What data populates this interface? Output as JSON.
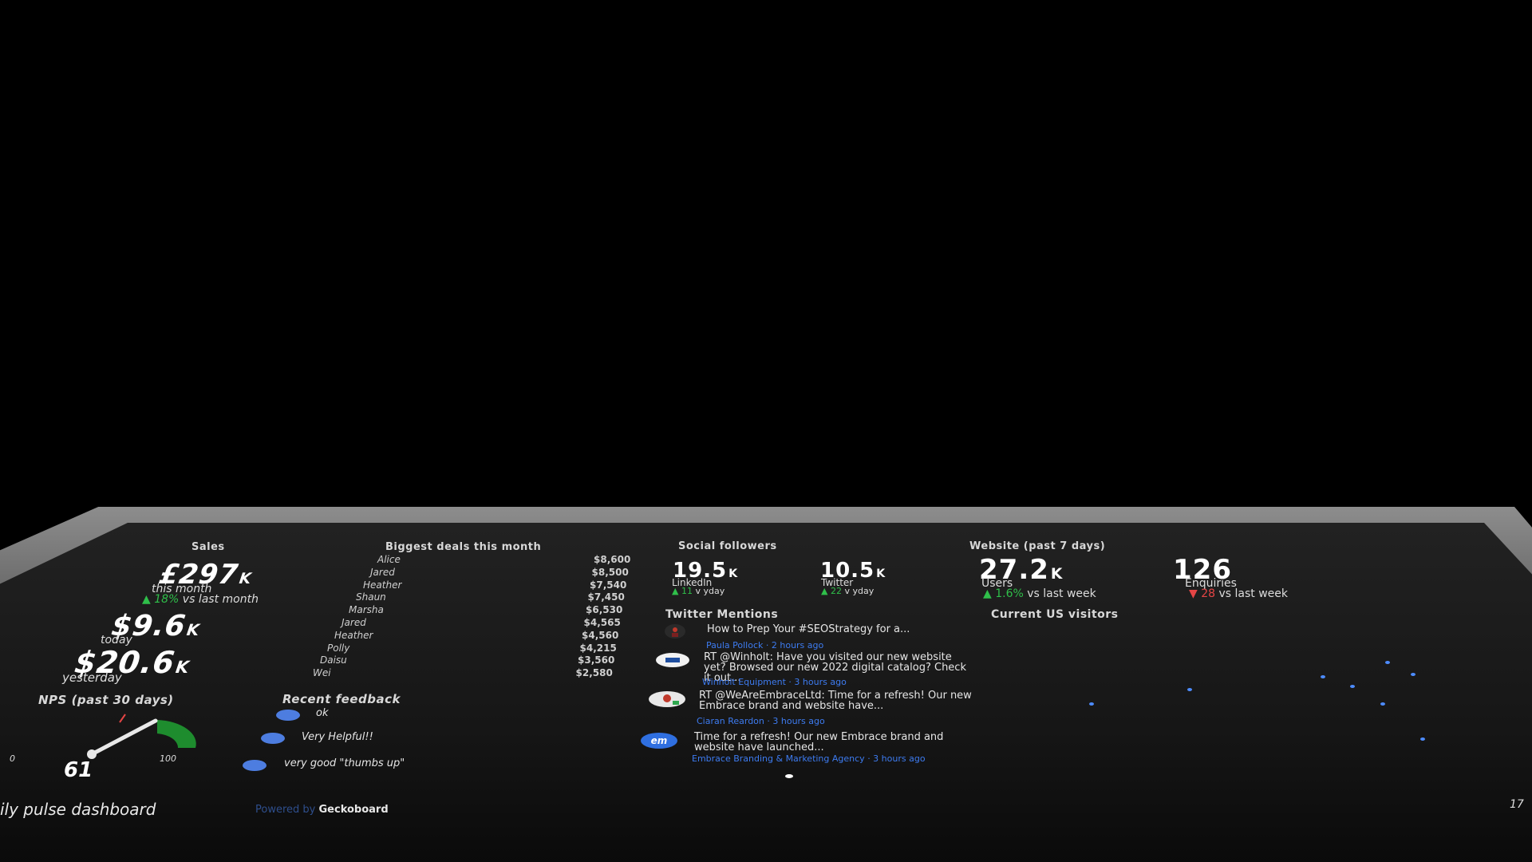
{
  "sales": {
    "title": "Sales",
    "month_value": "£297",
    "month_unit": "K",
    "month_label": "this month",
    "month_change": "▲ 18%",
    "month_change_suffix": "vs last month",
    "today_value": "$9.6",
    "today_unit": "K",
    "today_label": "today",
    "yesterday_value": "$20.6",
    "yesterday_unit": "K",
    "yesterday_label": "yesterday"
  },
  "deals": {
    "title": "Biggest deals this month",
    "rows": [
      {
        "name": "Alice",
        "value": "$8,600"
      },
      {
        "name": "Jared",
        "value": "$8,500"
      },
      {
        "name": "Heather",
        "value": "$7,540"
      },
      {
        "name": "Shaun",
        "value": "$7,450"
      },
      {
        "name": "Marsha",
        "value": "$6,530"
      },
      {
        "name": "Jared",
        "value": "$4,565"
      },
      {
        "name": "Heather",
        "value": "$4,560"
      },
      {
        "name": "Polly",
        "value": "$4,215"
      },
      {
        "name": "Daisu",
        "value": "$3,560"
      },
      {
        "name": "Wei",
        "value": "$2,580"
      }
    ]
  },
  "social": {
    "title": "Social followers",
    "linkedin_value": "19.5",
    "linkedin_unit": "K",
    "linkedin_label": "LinkedIn",
    "linkedin_change": "▲ 11",
    "linkedin_suffix": "v yday",
    "twitter_value": "10.5",
    "twitter_unit": "K",
    "twitter_label": "Twitter",
    "twitter_change": "▲ 22",
    "twitter_suffix": "v yday"
  },
  "website": {
    "title": "Website (past 7 days)",
    "users_value": "27.2",
    "users_unit": "K",
    "users_label": "Users",
    "users_change": "▲ 1.6%",
    "users_suffix": "vs last week",
    "enquiries_value": "126",
    "enquiries_label": "Enquiries",
    "enquiries_change": "▼ 28",
    "enquiries_suffix": "vs last week"
  },
  "twitter_mentions": {
    "title": "Twitter Mentions",
    "items": [
      {
        "text": "How to Prep Your #SEOStrategy for a...",
        "meta": "Paula Pollock · 2 hours ago"
      },
      {
        "text": "RT @Winholt: Have you visited our new website yet? Browsed our new 2022 digital catalog? Check it out...",
        "meta": "Winholt Equipment · 3 hours ago"
      },
      {
        "text": "RT @WeAreEmbraceLtd: Time for a refresh! Our new Embrace brand and website have...",
        "meta": "Ciaran Reardon · 3 hours ago"
      },
      {
        "text": "Time for a refresh! Our new Embrace brand and website have launched...",
        "meta": "Embrace Branding & Marketing Agency · 3 hours ago"
      }
    ],
    "avatar4_text": "em"
  },
  "us_visitors": {
    "title": "Current US visitors"
  },
  "nps": {
    "title": "NPS (past 30 days)",
    "value": "61",
    "min": "0",
    "max": "100",
    "fraction": 0.61
  },
  "feedback": {
    "title": "Recent feedback",
    "items": [
      {
        "text": "ok"
      },
      {
        "text": "Very Helpful!!"
      },
      {
        "text": "very good \"thumbs up\""
      }
    ]
  },
  "footer": {
    "title": "ily pulse dashboard",
    "powered_by": "Powered by",
    "brand": "Geckoboard",
    "right_text": "17"
  },
  "colors": {
    "positive": "#2fbf4a",
    "negative": "#e54545",
    "link": "#3d7bf0",
    "gauge": "#1e8c2e"
  }
}
